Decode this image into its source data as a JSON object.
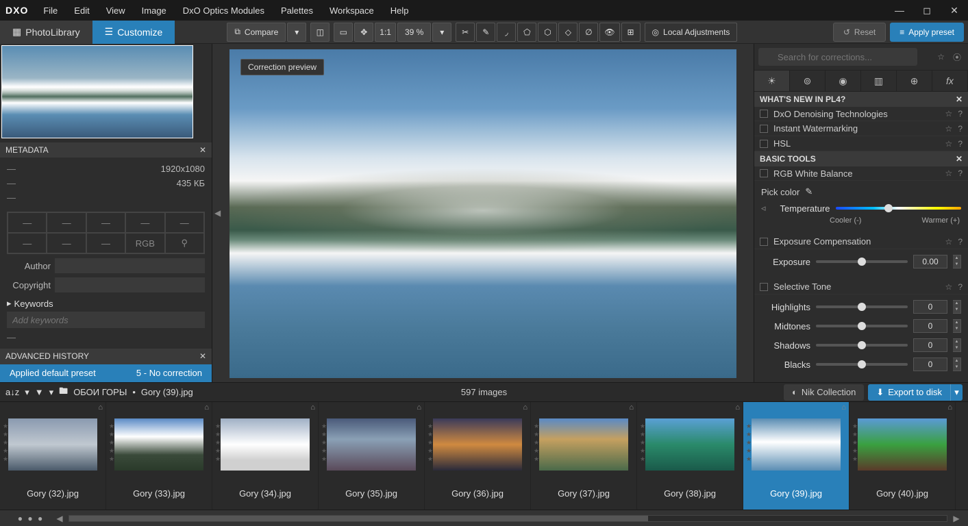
{
  "menu": [
    "File",
    "Edit",
    "View",
    "Image",
    "DxO Optics Modules",
    "Palettes",
    "Workspace",
    "Help"
  ],
  "logo": "DXO",
  "tabs": {
    "photolibrary": "PhotoLibrary",
    "customize": "Customize"
  },
  "toolbar": {
    "compare": "Compare",
    "zoom_ratio": "1:1",
    "zoom_pct": "39 %",
    "local_adjustments": "Local Adjustments",
    "reset": "Reset",
    "apply_preset": "Apply preset"
  },
  "viewer": {
    "correction_preview": "Correction preview"
  },
  "metadata": {
    "title": "METADATA",
    "dimensions": "1920x1080",
    "filesize": "435 КБ",
    "rgb": "RGB",
    "author_label": "Author",
    "copyright_label": "Copyright",
    "keywords_label": "Keywords",
    "keywords_placeholder": "Add keywords"
  },
  "history": {
    "title": "ADVANCED HISTORY",
    "entry": "Applied default preset",
    "detail": "5 - No correction"
  },
  "right": {
    "search_placeholder": "Search for corrections...",
    "whats_new": {
      "title": "WHAT'S NEW IN PL4?",
      "items": [
        "DxO Denoising Technologies",
        "Instant Watermarking",
        "HSL"
      ]
    },
    "basic_tools": {
      "title": "BASIC TOOLS"
    },
    "wb": {
      "title": "RGB White Balance",
      "pick_color": "Pick color",
      "temperature": "Temperature",
      "cooler": "Cooler (-)",
      "warmer": "Warmer (+)"
    },
    "exposure_comp": {
      "title": "Exposure Compensation",
      "exposure_label": "Exposure",
      "value": "0.00"
    },
    "selective": {
      "title": "Selective Tone",
      "highlights": "Highlights",
      "midtones": "Midtones",
      "shadows": "Shadows",
      "blacks": "Blacks",
      "val": "0"
    }
  },
  "pathbar": {
    "folder": "ОБОИ ГОРЫ",
    "sep": "•",
    "filename": "Gory (39).jpg",
    "count": "597 images",
    "nik": "Nik Collection",
    "export": "Export to disk"
  },
  "filmstrip": [
    {
      "name": "Gory (32).jpg"
    },
    {
      "name": "Gory (33).jpg"
    },
    {
      "name": "Gory (34).jpg"
    },
    {
      "name": "Gory (35).jpg"
    },
    {
      "name": "Gory (36).jpg"
    },
    {
      "name": "Gory (37).jpg"
    },
    {
      "name": "Gory (38).jpg"
    },
    {
      "name": "Gory (39).jpg"
    },
    {
      "name": "Gory (40).jpg"
    }
  ],
  "filmstrip_selected": 7
}
